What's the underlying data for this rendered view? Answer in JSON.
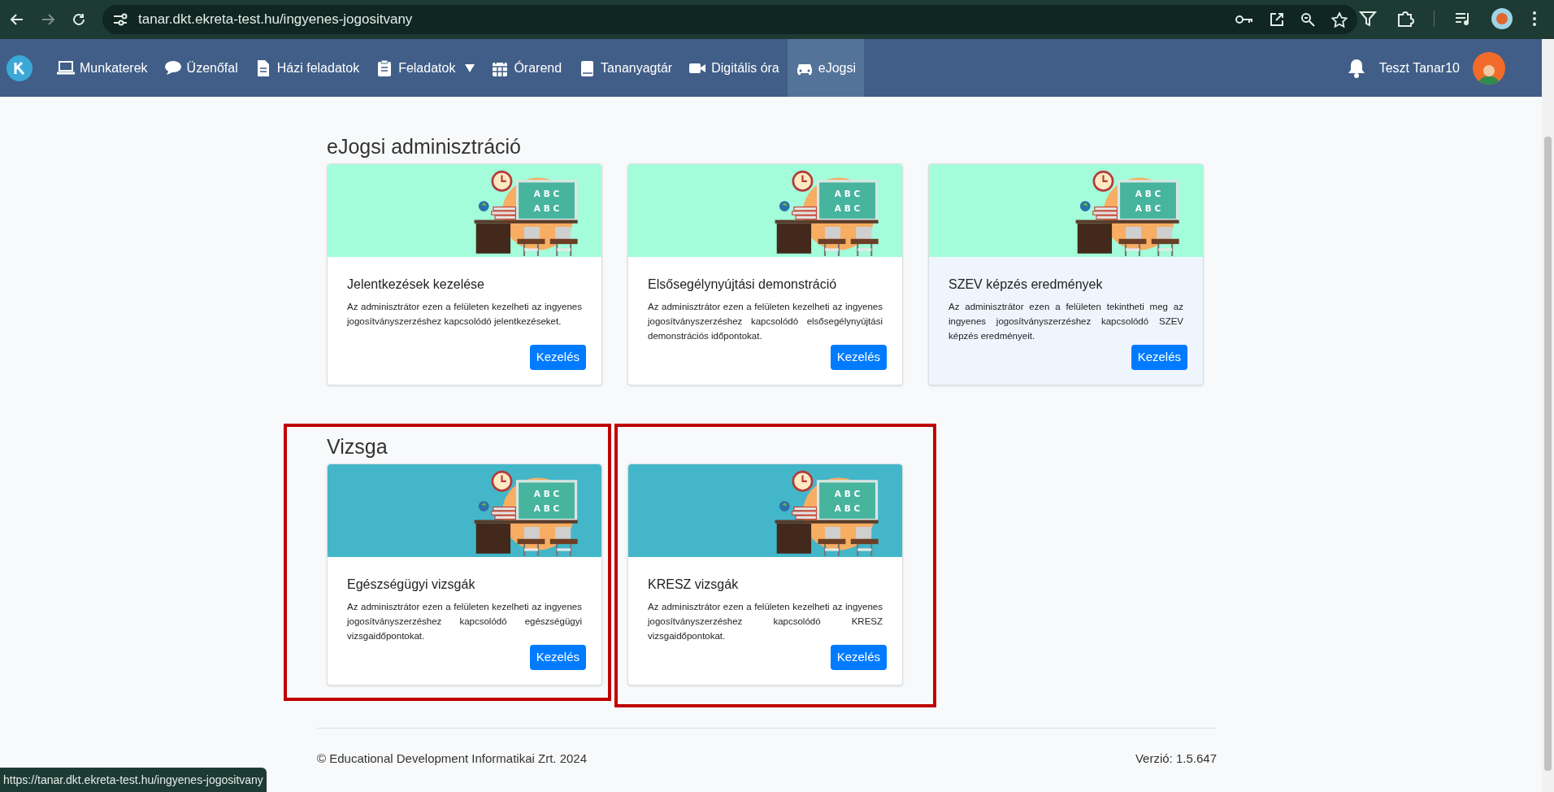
{
  "browser": {
    "url": "tanar.dkt.ekreta-test.hu/ingyenes-jogositvany",
    "status_url": "https://tanar.dkt.ekreta-test.hu/ingyenes-jogositvany"
  },
  "nav": {
    "items": [
      {
        "label": "Munkaterek",
        "kind": "laptop",
        "selected": false,
        "dropdown": false
      },
      {
        "label": "Üzenőfal",
        "kind": "bubble",
        "selected": false,
        "dropdown": false
      },
      {
        "label": "Házi feladatok",
        "kind": "document",
        "selected": false,
        "dropdown": false
      },
      {
        "label": "Feladatok",
        "kind": "clipboard",
        "selected": false,
        "dropdown": true
      },
      {
        "label": "Órarend",
        "kind": "calendar",
        "selected": false,
        "dropdown": false
      },
      {
        "label": "Tananyagtár",
        "kind": "book",
        "selected": false,
        "dropdown": false
      },
      {
        "label": "Digitális óra",
        "kind": "camera",
        "selected": false,
        "dropdown": false
      },
      {
        "label": "eJogsi",
        "kind": "car",
        "selected": true,
        "dropdown": false
      }
    ],
    "user": "Teszt Tanar10"
  },
  "sections": [
    {
      "title": "eJogsi adminisztráció",
      "color": "#a3fcda",
      "cards": [
        {
          "title": "Jelentkezések kezelése",
          "text": "Az adminisztrátor ezen a felületen kezelheti az ingyenes jogosítványszerzéshez kapcsolódó jelentkezéseket.",
          "button": "Kezelés",
          "board": [
            "A B C",
            "A B C"
          ],
          "hovered": false,
          "highlighted": false
        },
        {
          "title": "Elsősegélynyújtási demonstráció",
          "text": "Az adminisztrátor ezen a felületen kezelheti az ingyenes jogosítványszerzéshez kapcsolódó elsősegélynyújtási demonstrációs időpontokat.",
          "button": "Kezelés",
          "board": [
            "A B C",
            "A B C"
          ],
          "hovered": false,
          "highlighted": false
        },
        {
          "title": "SZEV képzés eredmények",
          "text": "Az adminisztrátor ezen a felületen tekintheti meg az ingyenes jogosítványszerzéshez kapcsolódó SZEV képzés eredményeit.",
          "button": "Kezelés",
          "board": [
            "A B C",
            "A B C"
          ],
          "hovered": true,
          "highlighted": false
        }
      ]
    },
    {
      "title": "Vizsga",
      "color": "#44b6c9",
      "cards": [
        {
          "title": "Egészségügyi vizsgák",
          "text": "Az adminisztrátor ezen a felületen kezelheti az ingyenes jogosítványszerzéshez kapcsolódó egészségügyi vizsgaidőpontokat.",
          "button": "Kezelés",
          "board": [
            "A B C",
            "A B C"
          ],
          "hovered": false,
          "highlighted": true
        },
        {
          "title": "KRESZ vizsgák",
          "text": "Az adminisztrátor ezen a felületen kezelheti az ingyenes jogosítványszerzéshez kapcsolódó KRESZ vizsgaidőpontokat.",
          "button": "Kezelés",
          "board": [
            "A B C",
            "A B C"
          ],
          "hovered": false,
          "highlighted": true
        }
      ]
    }
  ],
  "footer": {
    "copyright": "© Educational Development Informatikai Zrt. 2024",
    "version": "Verzió: 1.5.647"
  }
}
